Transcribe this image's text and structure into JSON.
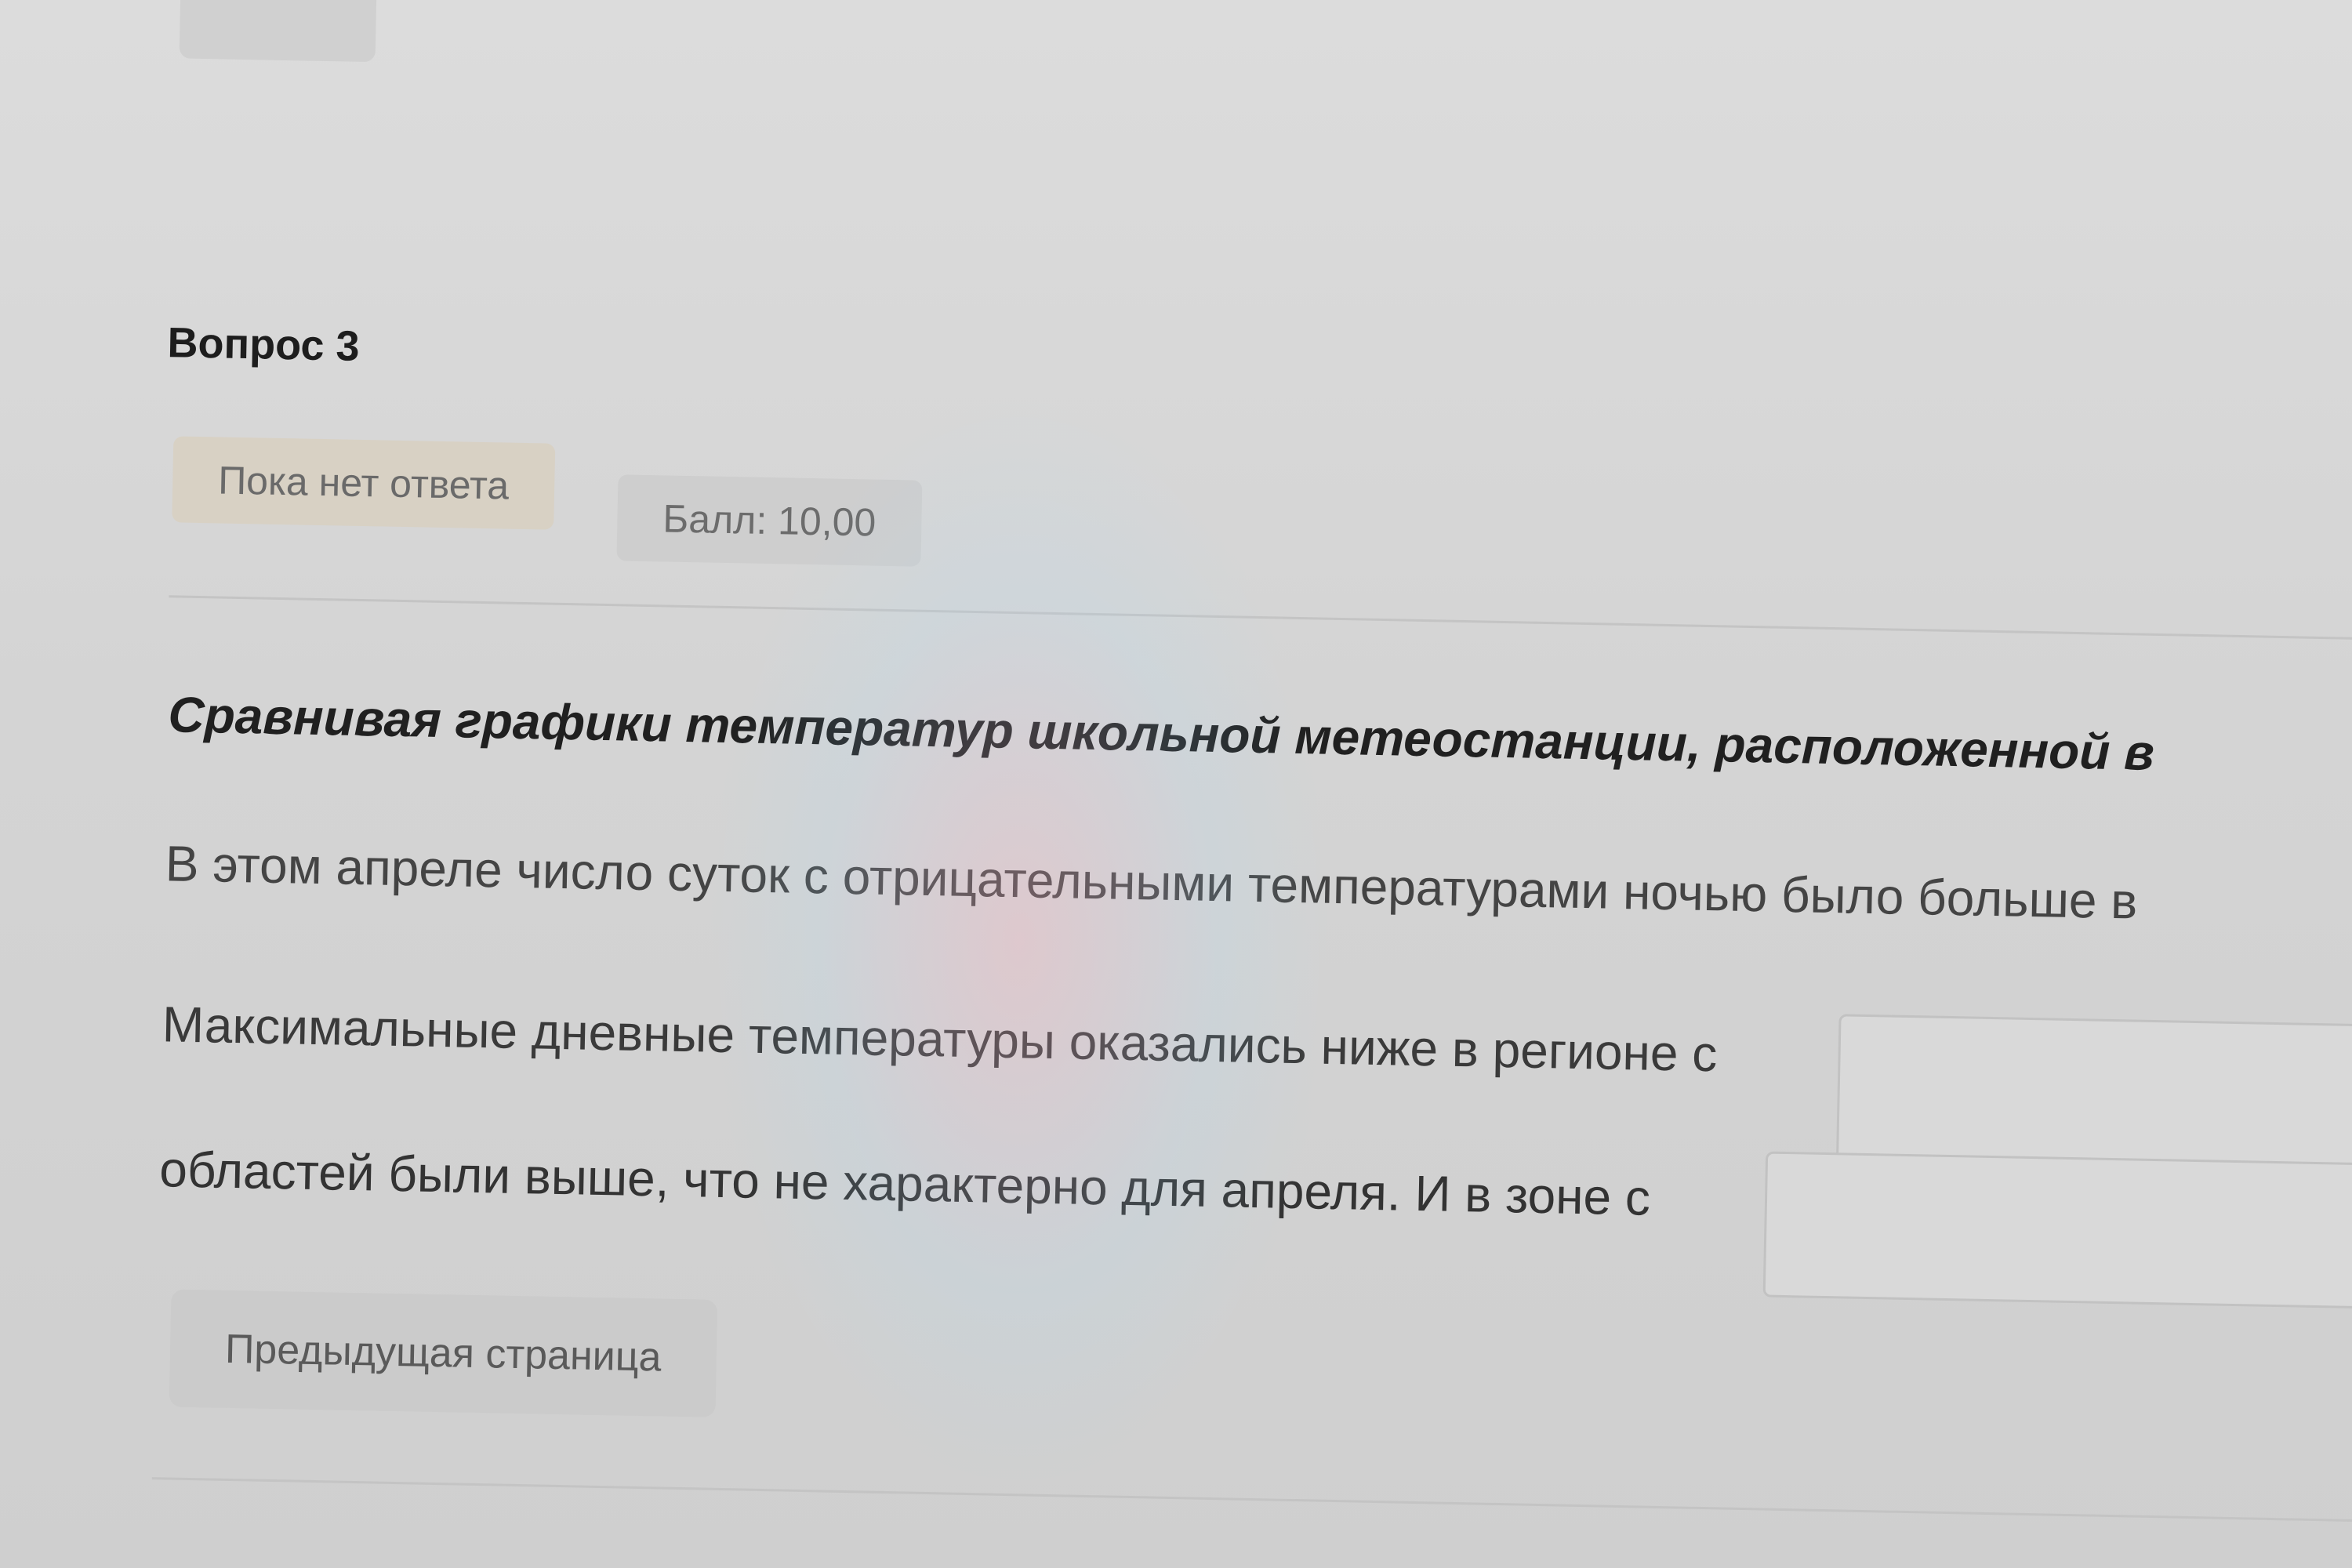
{
  "question": {
    "title": "Вопрос 3",
    "status": "Пока нет ответа",
    "grade": "Балл: 10,00",
    "text_bold": "Сравнивая графики температур школьной метеостанции, расположенной в",
    "line1": "В этом апреле число суток с отрицательными температурами ночью было больше в",
    "line2": "Максимальные дневные температуры оказались ниже в регионе с",
    "line3": "областей были выше, что не характерно для апреля. И в зоне с"
  },
  "nav": {
    "prev_label": "Предыдущая страница"
  }
}
